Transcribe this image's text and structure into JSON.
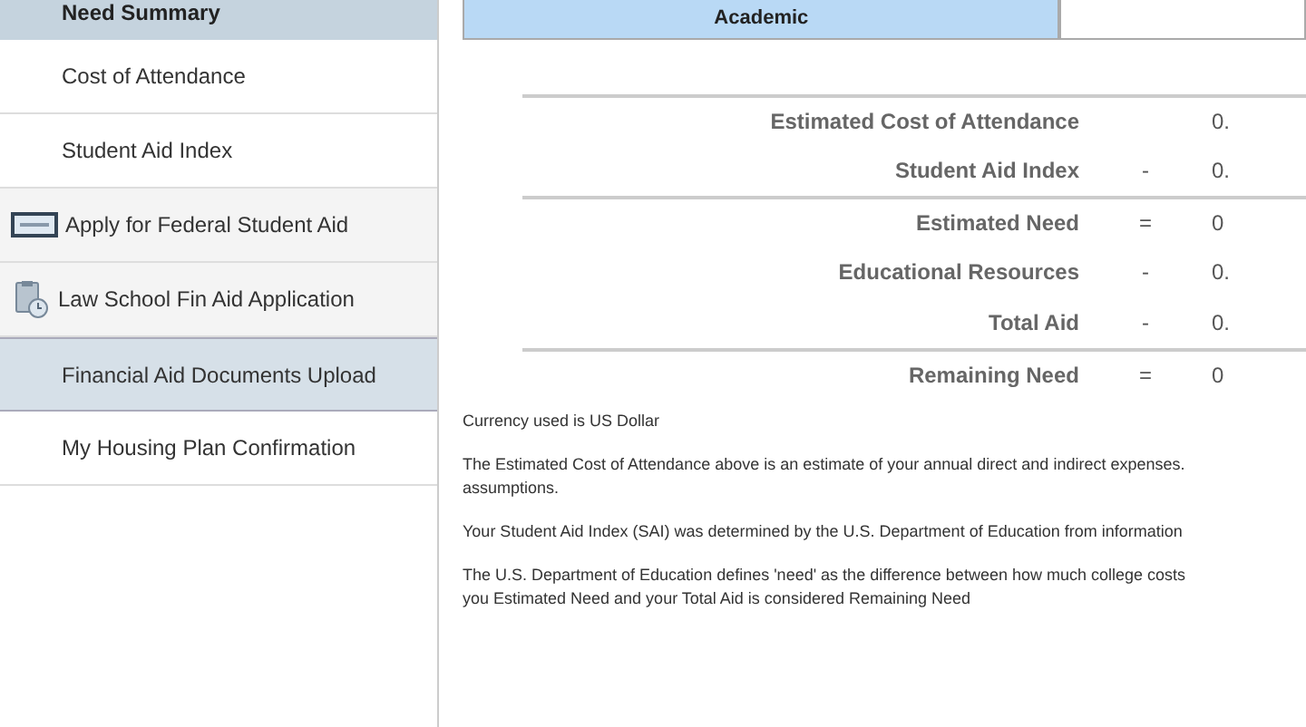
{
  "sidebar": {
    "header": "Need Summary",
    "items": [
      {
        "label": "Cost of Attendance",
        "kind": "sub",
        "selected": false
      },
      {
        "label": "Student Aid Index",
        "kind": "sub",
        "selected": false
      },
      {
        "label": "Apply for Federal Student Aid",
        "kind": "card",
        "selected": false
      },
      {
        "label": "Law School Fin Aid Application",
        "kind": "form",
        "selected": false
      },
      {
        "label": "Financial Aid Documents Upload",
        "kind": "sub",
        "selected": true
      },
      {
        "label": "My Housing Plan Confirmation",
        "kind": "sub",
        "selected": false
      }
    ]
  },
  "tabs": [
    {
      "label": "Academic",
      "selected": true
    },
    {
      "selected": false
    }
  ],
  "summary": [
    {
      "label": "Estimated Cost of Attendance",
      "value": "0.",
      "divider_above": true
    },
    {
      "label": "Student Aid Index",
      "operator": "-",
      "value": "0.",
      "divider_above": false
    },
    {
      "label": "Estimated Need",
      "operator": "=",
      "value": "0",
      "divider_above": true
    },
    {
      "label": "Educational Resources",
      "operator": "-",
      "value": "0.",
      "divider_above": false
    },
    {
      "label": "Total Aid",
      "operator": "-",
      "value": "0.",
      "divider_above": false
    },
    {
      "label": "Remaining Need",
      "operator": "=",
      "value": "0",
      "divider_above": true
    }
  ],
  "notes": [
    [
      "Currency used is US Dollar"
    ],
    [
      "The Estimated Cost of Attendance above is an estimate of your annual direct and indirect expenses.",
      "assumptions."
    ],
    [
      "Your Student Aid Index (SAI) was determined by the U.S. Department of Education from information"
    ],
    [
      "The U.S. Department of Education defines 'need' as the difference between how much college costs",
      "you Estimated Need and your Total Aid is considered Remaining Need"
    ]
  ]
}
